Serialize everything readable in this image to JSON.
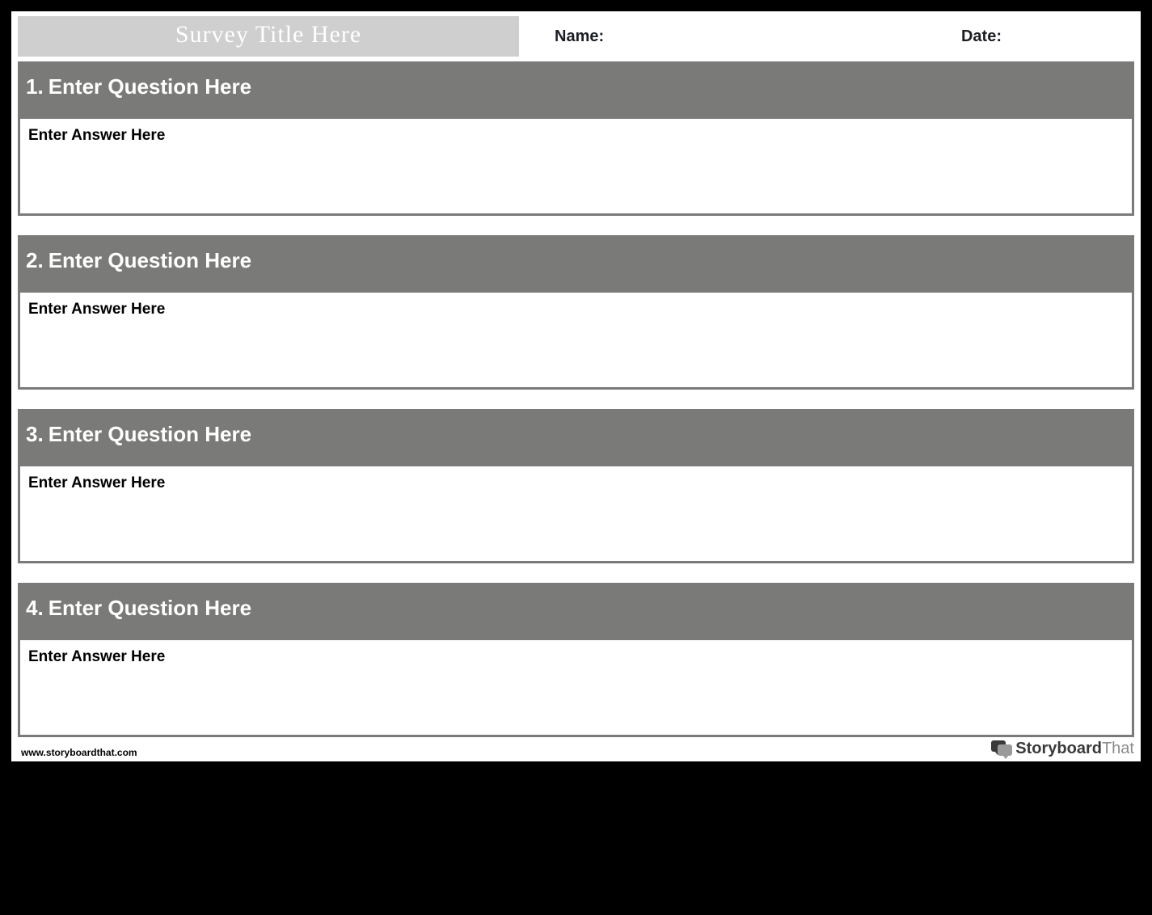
{
  "header": {
    "title": "Survey Title Here",
    "name_label": "Name:",
    "date_label": "Date:"
  },
  "questions": [
    {
      "number": "1.",
      "prompt": "Enter Question Here",
      "answer_placeholder": "Enter Answer Here"
    },
    {
      "number": "2.",
      "prompt": "Enter Question Here",
      "answer_placeholder": "Enter Answer Here"
    },
    {
      "number": "3.",
      "prompt": "Enter Question Here",
      "answer_placeholder": "Enter Answer Here"
    },
    {
      "number": "4.",
      "prompt": "Enter Question Here",
      "answer_placeholder": "Enter Answer Here"
    }
  ],
  "footer": {
    "url": "www.storyboardthat.com",
    "brand_a": "Storyboard",
    "brand_b": "That"
  }
}
